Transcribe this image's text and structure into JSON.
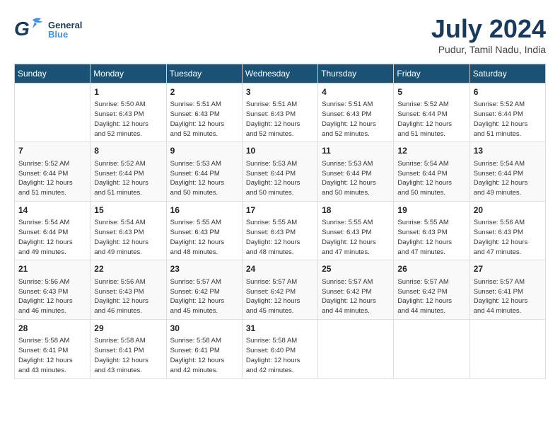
{
  "header": {
    "logo_general": "General",
    "logo_blue": "Blue",
    "month_title": "July 2024",
    "location": "Pudur, Tamil Nadu, India"
  },
  "weekdays": [
    "Sunday",
    "Monday",
    "Tuesday",
    "Wednesday",
    "Thursday",
    "Friday",
    "Saturday"
  ],
  "weeks": [
    [
      {
        "day": "",
        "info": ""
      },
      {
        "day": "1",
        "info": "Sunrise: 5:50 AM\nSunset: 6:43 PM\nDaylight: 12 hours\nand 52 minutes."
      },
      {
        "day": "2",
        "info": "Sunrise: 5:51 AM\nSunset: 6:43 PM\nDaylight: 12 hours\nand 52 minutes."
      },
      {
        "day": "3",
        "info": "Sunrise: 5:51 AM\nSunset: 6:43 PM\nDaylight: 12 hours\nand 52 minutes."
      },
      {
        "day": "4",
        "info": "Sunrise: 5:51 AM\nSunset: 6:43 PM\nDaylight: 12 hours\nand 52 minutes."
      },
      {
        "day": "5",
        "info": "Sunrise: 5:52 AM\nSunset: 6:44 PM\nDaylight: 12 hours\nand 51 minutes."
      },
      {
        "day": "6",
        "info": "Sunrise: 5:52 AM\nSunset: 6:44 PM\nDaylight: 12 hours\nand 51 minutes."
      }
    ],
    [
      {
        "day": "7",
        "info": "Sunrise: 5:52 AM\nSunset: 6:44 PM\nDaylight: 12 hours\nand 51 minutes."
      },
      {
        "day": "8",
        "info": "Sunrise: 5:52 AM\nSunset: 6:44 PM\nDaylight: 12 hours\nand 51 minutes."
      },
      {
        "day": "9",
        "info": "Sunrise: 5:53 AM\nSunset: 6:44 PM\nDaylight: 12 hours\nand 50 minutes."
      },
      {
        "day": "10",
        "info": "Sunrise: 5:53 AM\nSunset: 6:44 PM\nDaylight: 12 hours\nand 50 minutes."
      },
      {
        "day": "11",
        "info": "Sunrise: 5:53 AM\nSunset: 6:44 PM\nDaylight: 12 hours\nand 50 minutes."
      },
      {
        "day": "12",
        "info": "Sunrise: 5:54 AM\nSunset: 6:44 PM\nDaylight: 12 hours\nand 50 minutes."
      },
      {
        "day": "13",
        "info": "Sunrise: 5:54 AM\nSunset: 6:44 PM\nDaylight: 12 hours\nand 49 minutes."
      }
    ],
    [
      {
        "day": "14",
        "info": "Sunrise: 5:54 AM\nSunset: 6:44 PM\nDaylight: 12 hours\nand 49 minutes."
      },
      {
        "day": "15",
        "info": "Sunrise: 5:54 AM\nSunset: 6:43 PM\nDaylight: 12 hours\nand 49 minutes."
      },
      {
        "day": "16",
        "info": "Sunrise: 5:55 AM\nSunset: 6:43 PM\nDaylight: 12 hours\nand 48 minutes."
      },
      {
        "day": "17",
        "info": "Sunrise: 5:55 AM\nSunset: 6:43 PM\nDaylight: 12 hours\nand 48 minutes."
      },
      {
        "day": "18",
        "info": "Sunrise: 5:55 AM\nSunset: 6:43 PM\nDaylight: 12 hours\nand 47 minutes."
      },
      {
        "day": "19",
        "info": "Sunrise: 5:55 AM\nSunset: 6:43 PM\nDaylight: 12 hours\nand 47 minutes."
      },
      {
        "day": "20",
        "info": "Sunrise: 5:56 AM\nSunset: 6:43 PM\nDaylight: 12 hours\nand 47 minutes."
      }
    ],
    [
      {
        "day": "21",
        "info": "Sunrise: 5:56 AM\nSunset: 6:43 PM\nDaylight: 12 hours\nand 46 minutes."
      },
      {
        "day": "22",
        "info": "Sunrise: 5:56 AM\nSunset: 6:43 PM\nDaylight: 12 hours\nand 46 minutes."
      },
      {
        "day": "23",
        "info": "Sunrise: 5:57 AM\nSunset: 6:42 PM\nDaylight: 12 hours\nand 45 minutes."
      },
      {
        "day": "24",
        "info": "Sunrise: 5:57 AM\nSunset: 6:42 PM\nDaylight: 12 hours\nand 45 minutes."
      },
      {
        "day": "25",
        "info": "Sunrise: 5:57 AM\nSunset: 6:42 PM\nDaylight: 12 hours\nand 44 minutes."
      },
      {
        "day": "26",
        "info": "Sunrise: 5:57 AM\nSunset: 6:42 PM\nDaylight: 12 hours\nand 44 minutes."
      },
      {
        "day": "27",
        "info": "Sunrise: 5:57 AM\nSunset: 6:41 PM\nDaylight: 12 hours\nand 44 minutes."
      }
    ],
    [
      {
        "day": "28",
        "info": "Sunrise: 5:58 AM\nSunset: 6:41 PM\nDaylight: 12 hours\nand 43 minutes."
      },
      {
        "day": "29",
        "info": "Sunrise: 5:58 AM\nSunset: 6:41 PM\nDaylight: 12 hours\nand 43 minutes."
      },
      {
        "day": "30",
        "info": "Sunrise: 5:58 AM\nSunset: 6:41 PM\nDaylight: 12 hours\nand 42 minutes."
      },
      {
        "day": "31",
        "info": "Sunrise: 5:58 AM\nSunset: 6:40 PM\nDaylight: 12 hours\nand 42 minutes."
      },
      {
        "day": "",
        "info": ""
      },
      {
        "day": "",
        "info": ""
      },
      {
        "day": "",
        "info": ""
      }
    ]
  ]
}
